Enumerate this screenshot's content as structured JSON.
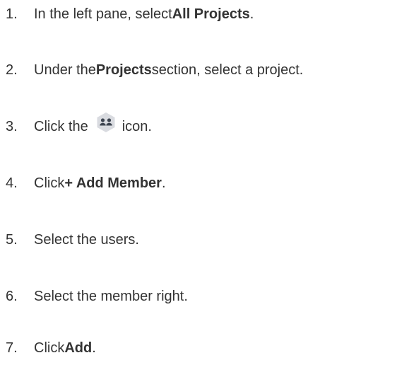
{
  "steps": [
    {
      "number": "1.",
      "before": "In the left pane, select ",
      "bold": "All Projects",
      "after": "."
    },
    {
      "number": "2.",
      "before": "Under the ",
      "bold": "Projects",
      "after": " section, select a project."
    },
    {
      "number": "3.",
      "before": "Click the ",
      "icon": "members-icon",
      "after": " icon."
    },
    {
      "number": "4.",
      "before": "Click ",
      "bold": "+ Add Member",
      "after": "."
    },
    {
      "number": "5.",
      "text": "Select the users."
    },
    {
      "number": "6.",
      "text": "Select the member right."
    },
    {
      "number": "7.",
      "before": "Click ",
      "bold": "Add",
      "after": "."
    }
  ],
  "colors": {
    "text": "#333333",
    "icon_hex": "#d9dbe0",
    "icon_glyph": "#3d4450"
  }
}
